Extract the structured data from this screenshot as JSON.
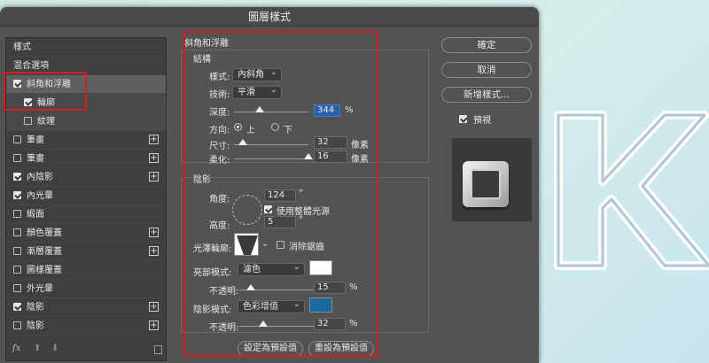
{
  "dialog": {
    "title": "圖層樣式"
  },
  "left_panel": {
    "items": [
      {
        "label": "樣式",
        "checkbox": false,
        "plus": false
      },
      {
        "label": "混合選項",
        "checkbox": false,
        "plus": false
      },
      {
        "label": "斜角和浮雕",
        "checkbox": true,
        "checked": true,
        "plus": false
      },
      {
        "label": "輪廓",
        "checkbox": true,
        "checked": true,
        "plus": false
      },
      {
        "label": "紋理",
        "checkbox": true,
        "checked": false,
        "plus": false
      },
      {
        "label": "筆畫",
        "checkbox": true,
        "checked": false,
        "plus": true
      },
      {
        "label": "筆畫",
        "checkbox": true,
        "checked": false,
        "plus": true
      },
      {
        "label": "內陰影",
        "checkbox": true,
        "checked": true,
        "plus": true
      },
      {
        "label": "內光暈",
        "checkbox": true,
        "checked": true,
        "plus": false
      },
      {
        "label": "緞面",
        "checkbox": true,
        "checked": false,
        "plus": false
      },
      {
        "label": "顏色覆蓋",
        "checkbox": true,
        "checked": false,
        "plus": true
      },
      {
        "label": "漸層覆蓋",
        "checkbox": true,
        "checked": false,
        "plus": true
      },
      {
        "label": "圖樣覆蓋",
        "checkbox": true,
        "checked": false,
        "plus": false
      },
      {
        "label": "外光暈",
        "checkbox": true,
        "checked": false,
        "plus": false
      },
      {
        "label": "陰影",
        "checkbox": true,
        "checked": true,
        "plus": true
      },
      {
        "label": "陰影",
        "checkbox": true,
        "checked": false,
        "plus": true
      }
    ],
    "footer": {
      "fx": "fx",
      "up": "⬆",
      "down": "⬇",
      "trash": "🗑"
    }
  },
  "bevel": {
    "section_title": "斜角和浮雕",
    "structure_title": "結構",
    "style_label": "樣式:",
    "style_value": "內斜角",
    "technique_label": "技術:",
    "technique_value": "平滑",
    "depth_label": "深度:",
    "depth_value": "344",
    "depth_level": 0.34,
    "direction_label": "方向:",
    "direction_up": "上",
    "direction_down": "下",
    "size_label": "尺寸:",
    "size_value": "32",
    "size_level": 0.12,
    "soften_label": "柔化:",
    "soften_value": "16",
    "soften_level": 1.0,
    "pct": "%",
    "px": "像素",
    "shading_title": "陰影",
    "angle_label": "角度:",
    "angle_value": "124",
    "deg": "°",
    "global_light_label": "使用整體光源",
    "altitude_label": "高度:",
    "altitude_value": "5",
    "gloss_label": "光澤輪廓:",
    "antialias_label": "消除鋸齒",
    "highlight_mode_label": "亮部模式:",
    "highlight_mode_value": "濾色",
    "highlight_color": "#ffffff",
    "highlight_opacity_label": "不透明:",
    "highlight_opacity_value": "15",
    "highlight_opacity_level": 0.15,
    "shadow_mode_label": "陰影模式:",
    "shadow_mode_value": "色彩增值",
    "shadow_color": "#1a6a9e",
    "shadow_opacity_label": "不透明:",
    "shadow_opacity_value": "32",
    "shadow_opacity_level": 0.32,
    "make_default": "設定為預設值",
    "reset_default": "重設為預設值"
  },
  "right_panel": {
    "ok": "確定",
    "cancel": "取消",
    "new_style": "新增樣式...",
    "preview_label": "預視"
  },
  "colors": {
    "highlight_red": "#d81e1e"
  }
}
